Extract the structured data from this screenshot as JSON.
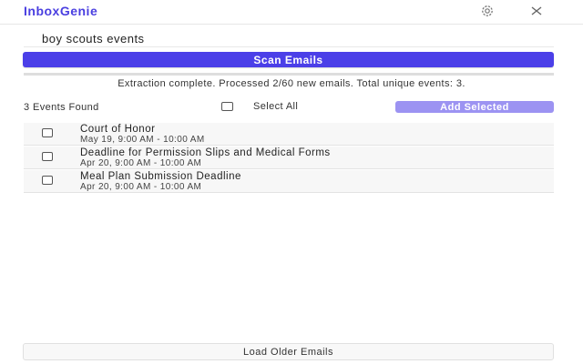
{
  "app": {
    "name": "InboxGenie",
    "brand_color": "#4a3fe0"
  },
  "header": {
    "settings_icon": "gear-icon",
    "close_icon": "close-icon"
  },
  "search": {
    "value": "boy scouts events",
    "placeholder": ""
  },
  "scan_button": {
    "label": "Scan Emails",
    "color": "#4b3fe8"
  },
  "status": {
    "text": "Extraction complete. Processed 2/60 new emails. Total unique events: 3."
  },
  "toolbar": {
    "count_text": "3 Events Found",
    "select_all_label": "Select All",
    "add_selected_label": "Add Selected",
    "add_selected_color": "#9c93f2"
  },
  "events": [
    {
      "title": "Court of Honor",
      "time": "May 19, 9:00 AM - 10:00 AM",
      "checked": false
    },
    {
      "title": "Deadline for Permission Slips and Medical Forms",
      "time": "Apr 20, 9:00 AM - 10:00 AM",
      "checked": false
    },
    {
      "title": "Meal Plan Submission Deadline",
      "time": "Apr 20, 9:00 AM - 10:00 AM",
      "checked": false
    }
  ],
  "footer": {
    "load_older_label": "Load Older Emails"
  }
}
